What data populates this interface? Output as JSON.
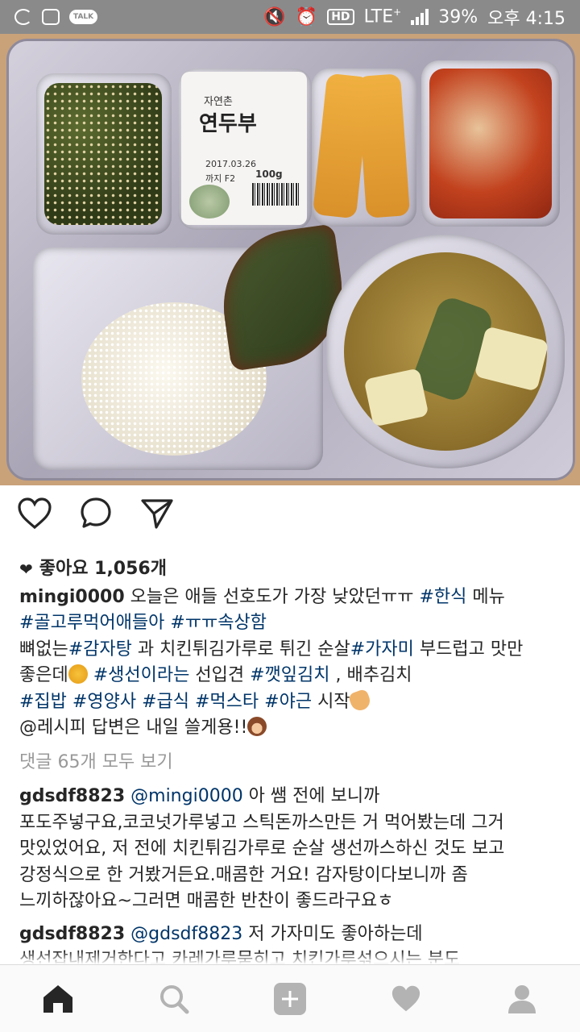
{
  "status_bar": {
    "battery": "39%",
    "time": "오후 4:15",
    "network": "LTE",
    "network_plus": "+",
    "hd_label": "HD",
    "talk_label": "TALK"
  },
  "photo": {
    "tofu_brand": "자연촌",
    "tofu_name": "연두부",
    "tofu_date": "2017.03.26",
    "tofu_lot": "까지 F2",
    "tofu_weight": "100g"
  },
  "actions": {
    "like_icon": "heart-outline-icon",
    "comment_icon": "comment-bubble-icon",
    "share_icon": "paper-plane-icon"
  },
  "post": {
    "likes_label": "좋아요 1,056개",
    "caption_user": "mingi0000",
    "caption_lines": [
      [
        {
          "t": " 오늘은 애들 선호도가 가장 낮았던ㅠㅠ "
        },
        {
          "tag": "#한식"
        },
        {
          "t": " 메뉴"
        }
      ],
      [
        {
          "tag": "#골고루먹어애들아"
        },
        {
          "t": " "
        },
        {
          "tag": "#ㅠㅠ속상함"
        }
      ],
      [
        {
          "t": "뼈없는"
        },
        {
          "tag": "#감자탕"
        },
        {
          "t": " 과 치킨튀김가루로 튀긴 순살"
        },
        {
          "tag": "#가자미"
        },
        {
          "t": " 부드럽고 맛만"
        }
      ],
      [
        {
          "t": "좋은데"
        },
        {
          "emoji": "e1"
        },
        {
          "t": " "
        },
        {
          "tag": "#생선이라는"
        },
        {
          "t": " 선입견 "
        },
        {
          "tag": "#깻잎김치"
        },
        {
          "t": " , 배추김치"
        }
      ],
      [
        {
          "tag": "#집밥"
        },
        {
          "t": " "
        },
        {
          "tag": "#영양사"
        },
        {
          "t": " "
        },
        {
          "tag": "#급식"
        },
        {
          "t": " "
        },
        {
          "tag": "#먹스타"
        },
        {
          "t": " "
        },
        {
          "tag": "#야근"
        },
        {
          "t": " 시작"
        },
        {
          "emoji": "e2"
        }
      ],
      [
        {
          "t": "@레시피 답변은 내일 쓸게용!!"
        },
        {
          "emoji": "e3"
        }
      ]
    ],
    "view_comments": "댓글 65개 모두 보기",
    "comments": [
      {
        "user": "gdsdf8823",
        "lines": [
          [
            {
              "tag": " @mingi0000"
            },
            {
              "t": " 아 쌤 전에 보니까"
            }
          ],
          [
            {
              "t": "포도주넣구요,코코넛가루넣고 스틱돈까스만든 거 먹어봤는데 그거"
            }
          ],
          [
            {
              "t": "맛있었어요, 저 전에 치킨튀김가루로 순살 생선까스하신 것도 보고"
            }
          ],
          [
            {
              "t": "강정식으로 한 거봤거든요.매콤한 거요! 감자탕이다보니까  좀"
            }
          ],
          [
            {
              "t": "느끼하잖아요~그러면 매콤한  반찬이 좋드라구요ㅎ"
            }
          ]
        ]
      },
      {
        "user": "gdsdf8823",
        "lines": [
          [
            {
              "tag": " @gdsdf8823"
            },
            {
              "t": " 저  가자미도 좋아하는데"
            }
          ],
          [
            {
              "t": "생선잡내제거한다고 카레가루묻히고 치킨가루섞으시는 분도"
            }
          ]
        ]
      }
    ]
  },
  "bottom_nav": [
    "home-icon",
    "search-icon",
    "add-post-icon",
    "activity-heart-icon",
    "profile-icon"
  ]
}
